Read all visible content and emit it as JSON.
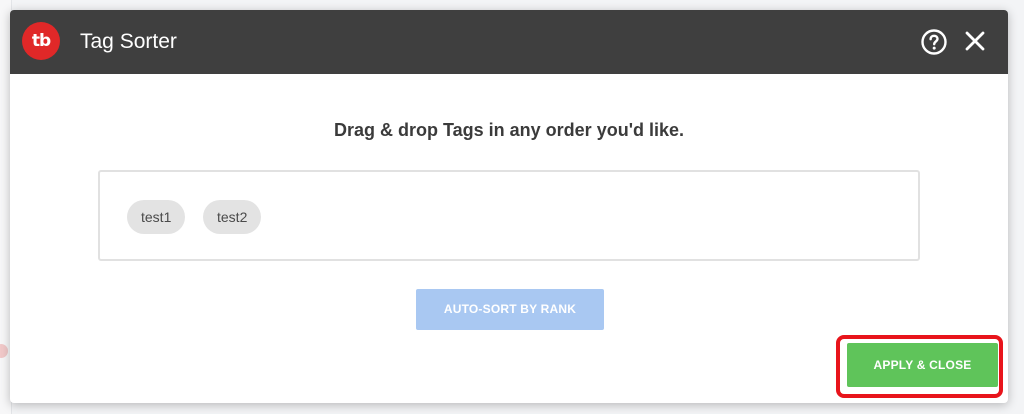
{
  "dialog": {
    "title": "Tag Sorter",
    "logo_text": "tb",
    "instructions": "Drag & drop Tags in any order you'd like.",
    "tags": [
      "test1",
      "test2"
    ],
    "autosort_label": "AUTO-SORT BY RANK",
    "apply_label": "APPLY & CLOSE",
    "icons": {
      "help": "help-circle-icon",
      "close": "close-icon",
      "logo": "tubebuddy-logo-icon"
    }
  },
  "colors": {
    "header_bg": "#3f3f3f",
    "logo_red": "#e02828",
    "autosort_bg": "#a9c8f2",
    "apply_bg": "#5fc45a",
    "highlight": "#e8141b"
  }
}
